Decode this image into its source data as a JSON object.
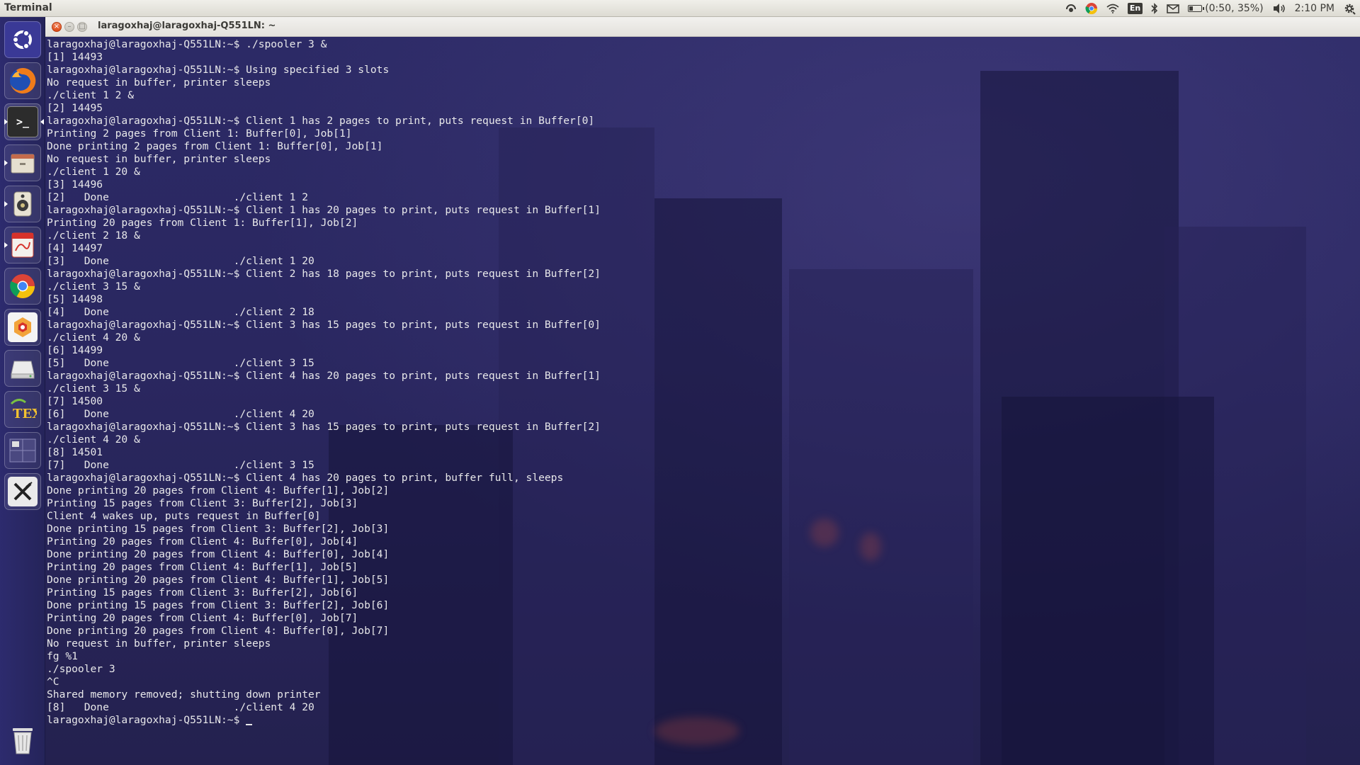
{
  "top_panel": {
    "app_title": "Terminal",
    "keyboard_layout": "En",
    "battery": {
      "text": "(0:50, 35%)",
      "level_percent": 35
    },
    "clock": "2:10 PM"
  },
  "launcher": {
    "items": [
      {
        "name": "ubuntu-dash-icon",
        "color": "#3b3a8a"
      },
      {
        "name": "firefox-icon",
        "color": "#e66000"
      },
      {
        "name": "terminal-icon",
        "color": "#2c2c2c"
      },
      {
        "name": "files-icon",
        "color": "#d9d2c2"
      },
      {
        "name": "speaker-app-icon",
        "color": "#e8e3d3"
      },
      {
        "name": "document-viewer-icon",
        "color": "#d6322b"
      },
      {
        "name": "chrome-icon",
        "color": "#4285f4"
      },
      {
        "name": "software-center-icon",
        "color": "#f4f4f4"
      },
      {
        "name": "drive-icon",
        "color": "#cfcfcf"
      },
      {
        "name": "texmaker-icon",
        "color": "#3a3a8a"
      },
      {
        "name": "workspace-switcher-icon",
        "color": "#5a5a8a"
      },
      {
        "name": "xsession-icon",
        "color": "#e8e8e8"
      }
    ],
    "trash": {
      "name": "trash-icon"
    }
  },
  "window": {
    "title": "laragoxhaj@laragoxhaj-Q551LN: ~"
  },
  "terminal": {
    "lines": [
      "laragoxhaj@laragoxhaj-Q551LN:~$ ./spooler 3 &",
      "[1] 14493",
      "laragoxhaj@laragoxhaj-Q551LN:~$ Using specified 3 slots",
      "No request in buffer, printer sleeps",
      "./client 1 2 &",
      "[2] 14495",
      "laragoxhaj@laragoxhaj-Q551LN:~$ Client 1 has 2 pages to print, puts request in Buffer[0]",
      "Printing 2 pages from Client 1: Buffer[0], Job[1]",
      "Done printing 2 pages from Client 1: Buffer[0], Job[1]",
      "No request in buffer, printer sleeps",
      "./client 1 20 &",
      "[3] 14496",
      "[2]   Done                    ./client 1 2",
      "laragoxhaj@laragoxhaj-Q551LN:~$ Client 1 has 20 pages to print, puts request in Buffer[1]",
      "Printing 20 pages from Client 1: Buffer[1], Job[2]",
      "./client 2 18 &",
      "[4] 14497",
      "[3]   Done                    ./client 1 20",
      "laragoxhaj@laragoxhaj-Q551LN:~$ Client 2 has 18 pages to print, puts request in Buffer[2]",
      "./client 3 15 &",
      "[5] 14498",
      "[4]   Done                    ./client 2 18",
      "laragoxhaj@laragoxhaj-Q551LN:~$ Client 3 has 15 pages to print, puts request in Buffer[0]",
      "./client 4 20 &",
      "[6] 14499",
      "[5]   Done                    ./client 3 15",
      "laragoxhaj@laragoxhaj-Q551LN:~$ Client 4 has 20 pages to print, puts request in Buffer[1]",
      "./client 3 15 &",
      "[7] 14500",
      "[6]   Done                    ./client 4 20",
      "laragoxhaj@laragoxhaj-Q551LN:~$ Client 3 has 15 pages to print, puts request in Buffer[2]",
      "./client 4 20 &",
      "[8] 14501",
      "[7]   Done                    ./client 3 15",
      "laragoxhaj@laragoxhaj-Q551LN:~$ Client 4 has 20 pages to print, buffer full, sleeps",
      "Done printing 20 pages from Client 4: Buffer[1], Job[2]",
      "Printing 15 pages from Client 3: Buffer[2], Job[3]",
      "Client 4 wakes up, puts request in Buffer[0]",
      "Done printing 15 pages from Client 3: Buffer[2], Job[3]",
      "Printing 20 pages from Client 4: Buffer[0], Job[4]",
      "Done printing 20 pages from Client 4: Buffer[0], Job[4]",
      "Printing 20 pages from Client 4: Buffer[1], Job[5]",
      "Done printing 20 pages from Client 4: Buffer[1], Job[5]",
      "Printing 15 pages from Client 3: Buffer[2], Job[6]",
      "Done printing 15 pages from Client 3: Buffer[2], Job[6]",
      "Printing 20 pages from Client 4: Buffer[0], Job[7]",
      "Done printing 20 pages from Client 4: Buffer[0], Job[7]",
      "No request in buffer, printer sleeps",
      "fg %1",
      "./spooler 3",
      "^C",
      "Shared memory removed; shutting down printer",
      "[8]   Done                    ./client 4 20"
    ],
    "prompt": "laragoxhaj@laragoxhaj-Q551LN:~$ "
  }
}
